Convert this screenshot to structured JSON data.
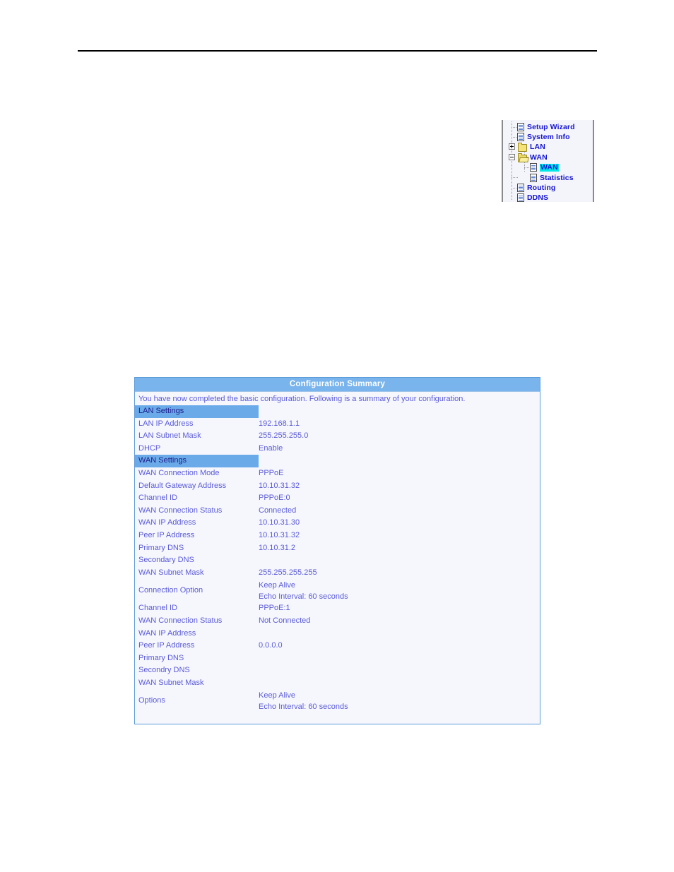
{
  "tree": {
    "items": [
      {
        "label": "Setup Wizard",
        "icon": "page-icon",
        "indent": 1,
        "expander": null,
        "selected": false
      },
      {
        "label": "System Info",
        "icon": "page-icon",
        "indent": 1,
        "expander": null,
        "selected": false
      },
      {
        "label": "LAN",
        "icon": "folder-closed-icon",
        "indent": 0,
        "expander": "plus",
        "selected": false
      },
      {
        "label": "WAN",
        "icon": "folder-open-icon",
        "indent": 0,
        "expander": "minus",
        "selected": false
      },
      {
        "label": "WAN",
        "icon": "page-icon",
        "indent": 2,
        "expander": null,
        "selected": true
      },
      {
        "label": "Statistics",
        "icon": "page-icon",
        "indent": 2,
        "expander": null,
        "selected": false
      },
      {
        "label": "Routing",
        "icon": "page-icon",
        "indent": 1,
        "expander": null,
        "selected": false
      },
      {
        "label": "DDNS",
        "icon": "page-icon",
        "indent": 1,
        "expander": null,
        "selected": false
      }
    ]
  },
  "summary": {
    "title": "Configuration Summary",
    "intro": "You have now completed the basic configuration. Following is a summary of your configuration.",
    "rows": [
      {
        "label": "LAN Settings",
        "value": "",
        "section": true
      },
      {
        "label": "LAN IP Address",
        "value": "192.168.1.1",
        "section": false
      },
      {
        "label": "LAN Subnet Mask",
        "value": "255.255.255.0",
        "section": false
      },
      {
        "label": "DHCP",
        "value": "Enable",
        "section": false
      },
      {
        "label": "WAN Settings",
        "value": "",
        "section": true
      },
      {
        "label": "WAN Connection Mode",
        "value": "PPPoE",
        "section": false
      },
      {
        "label": "Default Gateway Address",
        "value": "10.10.31.32",
        "section": false
      },
      {
        "label": "Channel ID",
        "value": "PPPoE:0",
        "section": false
      },
      {
        "label": "WAN Connection Status",
        "value": "Connected",
        "section": false
      },
      {
        "label": "WAN IP Address",
        "value": "10.10.31.30",
        "section": false
      },
      {
        "label": "Peer IP Address",
        "value": "10.10.31.32",
        "section": false
      },
      {
        "label": "Primary DNS",
        "value": "10.10.31.2",
        "section": false
      },
      {
        "label": "Secondary DNS",
        "value": "",
        "section": false
      },
      {
        "label": "WAN Subnet Mask",
        "value": "255.255.255.255",
        "section": false
      },
      {
        "label": "Connection Option",
        "value": "Keep Alive\nEcho Interval: 60 seconds",
        "section": false,
        "tall": true
      },
      {
        "label": "Channel ID",
        "value": "PPPoE:1",
        "section": false
      },
      {
        "label": "WAN Connection Status",
        "value": "Not Connected",
        "section": false
      },
      {
        "label": "WAN IP Address",
        "value": "",
        "section": false
      },
      {
        "label": "Peer IP Address",
        "value": "0.0.0.0",
        "section": false
      },
      {
        "label": "Primary DNS",
        "value": "",
        "section": false
      },
      {
        "label": "Secondry DNS",
        "value": "",
        "section": false
      },
      {
        "label": "WAN Subnet Mask",
        "value": "",
        "section": false
      },
      {
        "label": "Options",
        "value": "Keep Alive\nEcho Interval: 60 seconds",
        "section": false,
        "tall": true
      }
    ]
  },
  "colors": {
    "tree_text": "#1414d2",
    "tree_selected_bg": "#00e8e8",
    "table_header_bg": "#79b4ec",
    "table_section_bg": "#6aaae8",
    "table_text": "#5a5ad8",
    "table_border": "#5b9bd9"
  }
}
